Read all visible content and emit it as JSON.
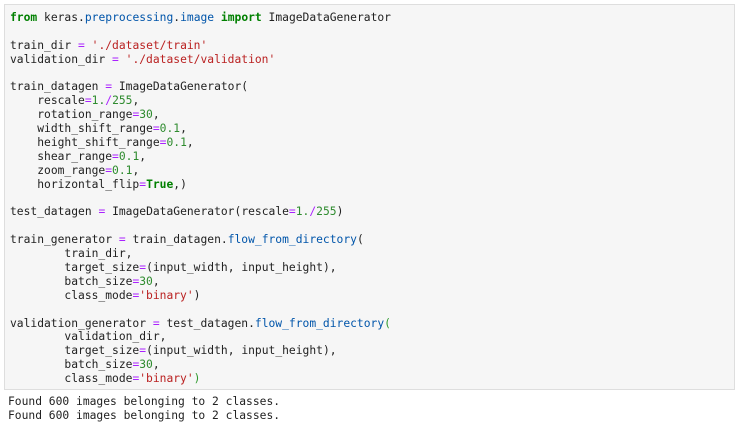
{
  "code": {
    "kw_from": "from",
    "kw_import": "import",
    "kw_true": "True",
    "mod_keras": "keras",
    "mod_preprocessing": "preprocessing",
    "mod_image": "image",
    "cls_idg": "ImageDataGenerator",
    "var_train_dir": "train_dir",
    "var_validation_dir": "validation_dir",
    "str_train_path": "'./dataset/train'",
    "str_validation_path": "'./dataset/validation'",
    "var_train_datagen": "train_datagen",
    "var_test_datagen": "test_datagen",
    "var_train_generator": "train_generator",
    "var_validation_generator": "validation_generator",
    "fn_flow": "flow_from_directory",
    "arg_rescale": "rescale",
    "arg_rotation": "rotation_range",
    "arg_width_shift": "width_shift_range",
    "arg_height_shift": "height_shift_range",
    "arg_shear": "shear_range",
    "arg_zoom": "zoom_range",
    "arg_hflip": "horizontal_flip",
    "arg_target_size": "target_size",
    "arg_batch_size": "batch_size",
    "arg_class_mode": "class_mode",
    "var_input_width": "input_width",
    "var_input_height": "input_height",
    "num_one": "1.",
    "num_255": "255",
    "num_30": "30",
    "num_01": "0.1",
    "str_binary": "'binary'"
  },
  "output": {
    "lines": [
      "Found 600 images belonging to 2 classes.",
      "Found 600 images belonging to 2 classes."
    ]
  }
}
